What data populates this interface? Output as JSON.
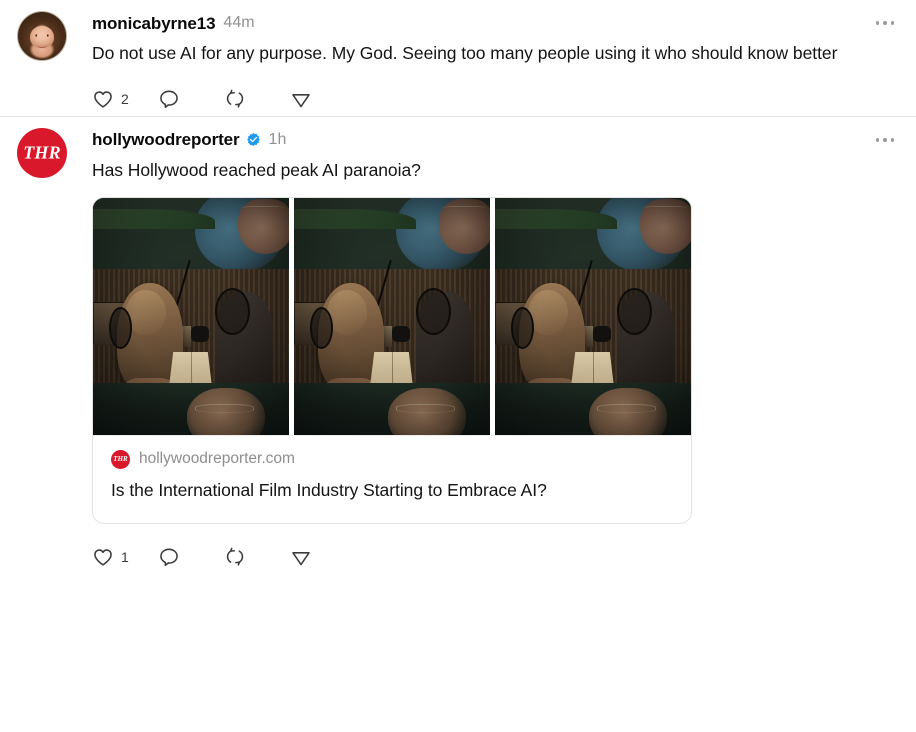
{
  "feed": {
    "posts": [
      {
        "id": "post-1",
        "author": {
          "username": "monicabyrne13",
          "verified": false,
          "avatar_type": "photo"
        },
        "timestamp": "44m",
        "text": "Do not use AI for any purpose. My God. Seeing too many people using it who should know better",
        "has_link_card": false,
        "actions": {
          "like_label": "Like",
          "like_count": "2",
          "reply_label": "Reply",
          "reply_count": "",
          "repost_label": "Repost",
          "repost_count": "",
          "share_label": "Share",
          "share_count": ""
        },
        "more_label": "More options"
      },
      {
        "id": "post-2",
        "author": {
          "username": "hollywoodreporter",
          "verified": true,
          "avatar_type": "thr-logo",
          "avatar_text": "THR"
        },
        "timestamp": "1h",
        "text": "Has Hollywood reached peak AI paranoia?",
        "has_link_card": true,
        "link_card": {
          "domain": "hollywoodreporter.com",
          "favicon_text": "THR",
          "title": "Is the International Film Industry Starting to Embrace AI?",
          "image_alt": "Film still of a recording studio session, three repeated panels",
          "panel_count": 3
        },
        "actions": {
          "like_label": "Like",
          "like_count": "1",
          "reply_label": "Reply",
          "reply_count": "",
          "repost_label": "Repost",
          "repost_count": "",
          "share_label": "Share",
          "share_count": ""
        },
        "more_label": "More options"
      }
    ]
  },
  "colors": {
    "text_primary": "#141414",
    "text_secondary": "#919191",
    "divider": "#e4e4e4",
    "verified_blue": "#1d9bf0",
    "brand_red": "#d9182b",
    "card_border": "#e3e3e3"
  },
  "icons": {
    "like": "heart-icon",
    "reply": "comment-icon",
    "repost": "repost-icon",
    "share": "share-icon",
    "more": "more-options-icon",
    "verified": "verified-badge-icon"
  }
}
